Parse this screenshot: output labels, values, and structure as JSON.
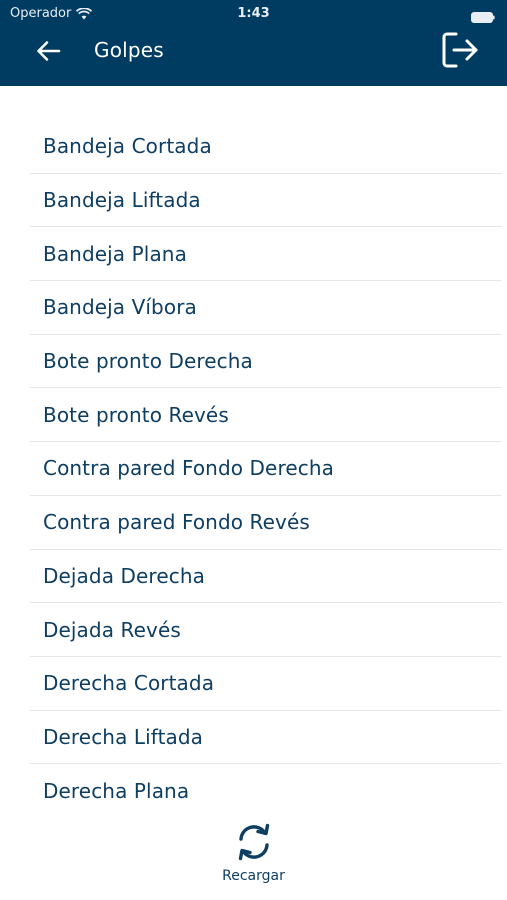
{
  "status_bar": {
    "carrier": "Operador",
    "time": "1:43"
  },
  "header": {
    "title": "Golpes",
    "back_icon": "arrow-left-icon",
    "logout_icon": "logout-icon"
  },
  "list": {
    "items": [
      "Bandeja Cortada",
      "Bandeja Liftada",
      "Bandeja Plana",
      "Bandeja Víbora",
      "Bote pronto Derecha",
      "Bote pronto Revés",
      "Contra pared Fondo Derecha",
      "Contra pared Fondo Revés",
      "Dejada Derecha",
      "Dejada Revés",
      "Derecha Cortada",
      "Derecha Liftada",
      "Derecha Plana"
    ]
  },
  "footer": {
    "reload_label": "Recargar",
    "reload_icon": "refresh-icon"
  },
  "colors": {
    "header_bg": "#003c61",
    "text_primary": "#0f3e63",
    "divider": "#e6e9ec"
  }
}
